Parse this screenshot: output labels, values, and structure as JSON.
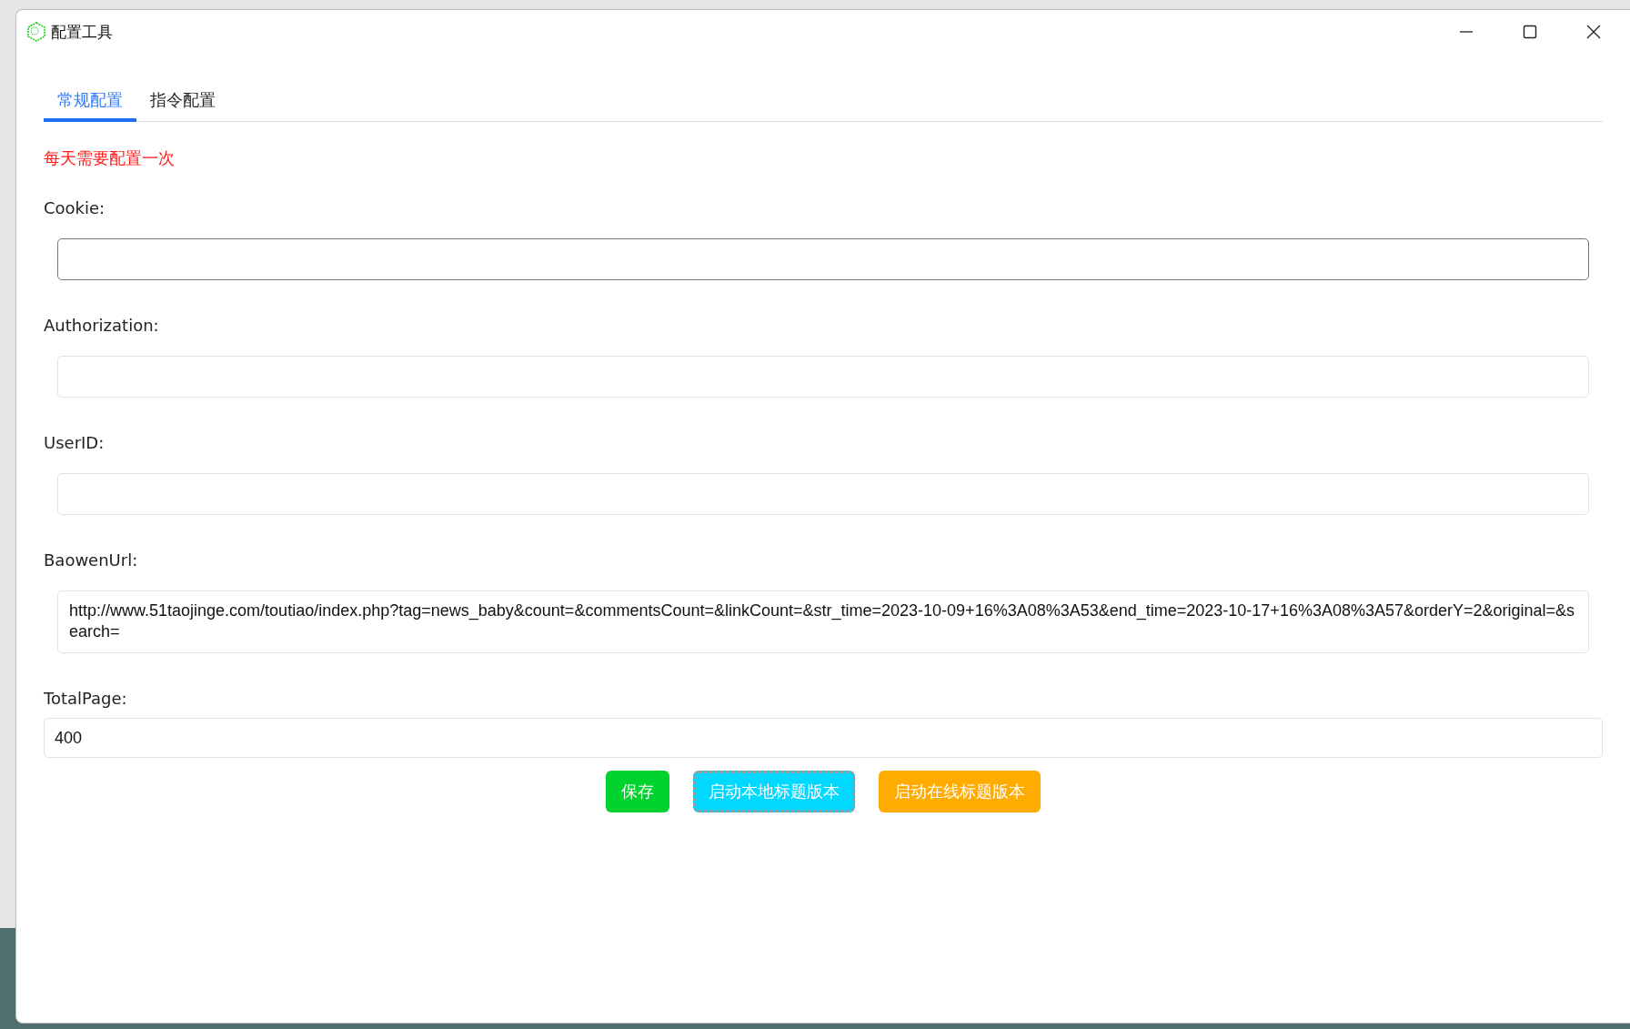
{
  "window": {
    "title": "配置工具"
  },
  "tabs": [
    {
      "label": "常规配置",
      "selected": true
    },
    {
      "label": "指令配置",
      "selected": false
    }
  ],
  "notice": "每天需要配置一次",
  "fields": [
    {
      "label": "Cookie:",
      "focused": true,
      "kind": "inset"
    },
    {
      "label": "Authorization:",
      "focused": false,
      "kind": "inset"
    },
    {
      "label": "UserID:",
      "focused": false,
      "kind": "inset"
    },
    {
      "label": "BaowenUrl:",
      "value": "http://www.51taojinge.com/toutiao/index.php?tag=news_baby&count=&commentsCount=&linkCount=&str_time=2023-10-09+16%3A08%3A53&end_time=2023-10-17+16%3A08%3A57&orderY=2&original=&search=",
      "focused": false,
      "kind": "multiline"
    },
    {
      "label": "TotalPage:",
      "value": "400",
      "focused": false,
      "kind": "full"
    }
  ],
  "buttons": [
    {
      "label": "保存",
      "color": "#00d22e",
      "focused": false
    },
    {
      "label": "启动本地标题版本",
      "color": "#00d8ff",
      "focused": true
    },
    {
      "label": "启动在线标题版本",
      "color": "#ffab00",
      "focused": false
    }
  ]
}
